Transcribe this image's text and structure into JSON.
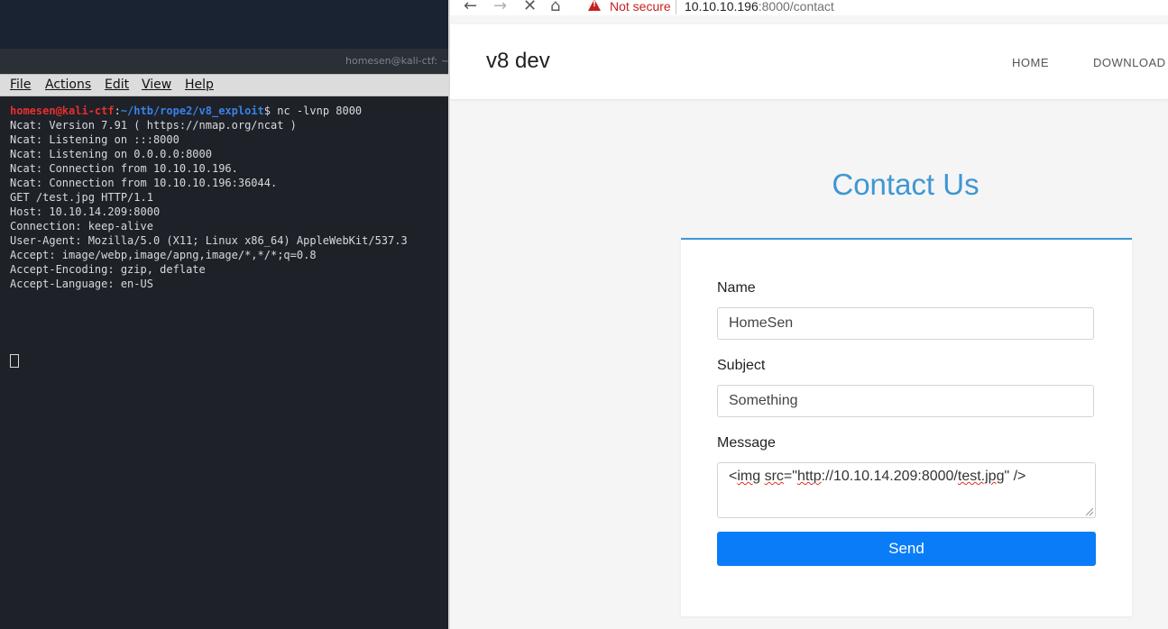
{
  "terminal": {
    "title": "homesen@kali-ctf: ~/",
    "menu": [
      "File",
      "Actions",
      "Edit",
      "View",
      "Help"
    ],
    "prompt_user": "homesen@kali-ctf",
    "prompt_sep": ":",
    "prompt_path": "~/htb/rope2/v8_exploit",
    "prompt_symbol": "$",
    "command": " nc -lvnp 8000",
    "output": [
      "Ncat: Version 7.91 ( https://nmap.org/ncat )",
      "Ncat: Listening on :::8000",
      "Ncat: Listening on 0.0.0.0:8000",
      "Ncat: Connection from 10.10.10.196.",
      "Ncat: Connection from 10.10.10.196:36044.",
      "GET /test.jpg HTTP/1.1",
      "Host: 10.10.14.209:8000",
      "Connection: keep-alive",
      "User-Agent: Mozilla/5.0 (X11; Linux x86_64) AppleWebKit/537.3",
      "Accept: image/webp,image/apng,image/*,*/*;q=0.8",
      "Accept-Encoding: gzip, deflate",
      "Accept-Language: en-US"
    ]
  },
  "browser": {
    "nav_icons": [
      "back-arrow-icon",
      "forward-arrow-icon",
      "stop-icon",
      "home-icon"
    ],
    "security_label": "Not secure",
    "url_host": "10.10.10.196",
    "url_rest": ":8000/contact",
    "site": {
      "brand": "v8 dev",
      "nav": [
        "HOME",
        "DOWNLOAD"
      ]
    },
    "contact": {
      "title": "Contact Us",
      "name_label": "Name",
      "name_value": "HomeSen",
      "subject_label": "Subject",
      "subject_value": "Something",
      "message_label": "Message",
      "message_parts": [
        "<",
        "img",
        " ",
        "src",
        "=\"",
        "http",
        "://10.10.14.209:8000/",
        "test.jpg",
        "\" />"
      ],
      "send_label": "Send"
    },
    "colors": {
      "accent": "#3f97d3",
      "button": "#0a7cf8",
      "warning": "#c5221f"
    }
  }
}
